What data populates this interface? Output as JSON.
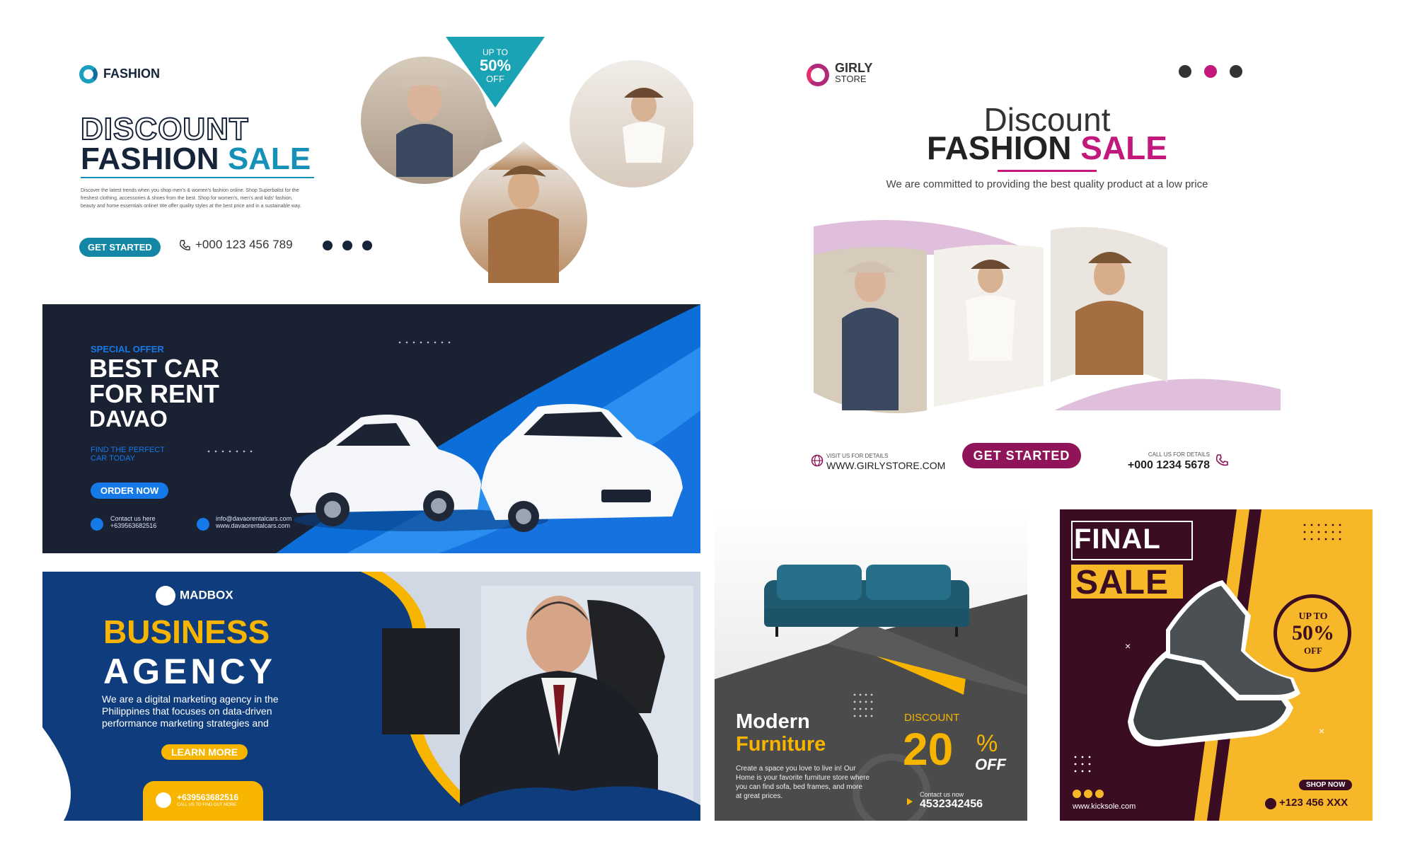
{
  "fashion_banner": {
    "brand": "FASHION",
    "headline_outline": "DISCOUNT",
    "headline_main": "FASHION",
    "headline_highlight": "SALE",
    "description": "Discover the latest trends when you shop men's & women's fashion online. Shop Superbalist for the freshest clothing, accessories & shoes from the best. Shop for women's, men's and kids' fashion, beauty and home essentials online! We offer quality styles at the best price and in a sustainable way.",
    "cta": "GET STARTED",
    "phone": "+000 123 456 789",
    "promo_up_to": "UP TO",
    "promo_percent": "50%",
    "promo_off": "OFF",
    "social_icons": [
      "facebook-icon",
      "twitter-icon",
      "pinterest-icon"
    ],
    "accent_color": "#1591b8"
  },
  "girly_banner": {
    "brand_line1": "GIRLY",
    "brand_line2": "STORE",
    "headline_light": "Discount",
    "headline_main": "FASHION",
    "headline_highlight": "SALE",
    "subtitle": "We are committed to providing the best quality product at a low price",
    "visit_label": "VISIT US FOR DETAILS",
    "url": "WWW.GIRLYSTORE.COM",
    "cta": "GET STARTED",
    "call_label": "CALL US FOR DETAILS",
    "phone": "+000 1234 5678",
    "social_icons": [
      "facebook-icon",
      "twitter-icon",
      "pinterest-icon"
    ],
    "accent_color": "#c2177b"
  },
  "car_banner": {
    "kicker": "SPECIAL OFFER",
    "line1": "BEST CAR",
    "line2": "FOR RENT",
    "line3": "DAVAO",
    "tagline_1": "FIND THE PERFECT",
    "tagline_2": "CAR TODAY",
    "cta": "ORDER NOW",
    "contact_label": "Contact us here",
    "contact_phone": "+639563682516",
    "email": "info@davaorentalcars.com",
    "website": "www.davaorentalcars.com",
    "accent_color": "#1579e8"
  },
  "agency_banner": {
    "brand": "MADBOX",
    "headline_1": "BUSINESS",
    "headline_2": "AGENCY",
    "description": "We are a digital marketing agency in the Philippines that focuses on data-driven performance marketing strategies and",
    "cta": "LEARN MORE",
    "phone": "+639563682516",
    "phone_sub": "CALL US TO FIND OUT MORE",
    "accent_color": "#f7b500"
  },
  "furniture_banner": {
    "headline_1": "Modern",
    "headline_2": "Furniture",
    "description": "Create a space you love to live in! Our Home is your favorite furniture store where you can find sofa, bed frames, and more at great prices.",
    "discount_label": "DISCOUNT",
    "discount_value": "20",
    "discount_percent": "%",
    "discount_off": "OFF",
    "contact_label": "Contact us now",
    "contact_phone": "4532342456"
  },
  "shoe_banner": {
    "line1": "FINAL",
    "line2": "SALE",
    "up_to": "UP TO",
    "percent": "50%",
    "off": "OFF",
    "cta": "SHOP NOW",
    "phone": "+123 456 XXX",
    "url": "www.kicksole.com",
    "social_icons": [
      "facebook-icon",
      "twitter-icon",
      "instagram-icon"
    ]
  }
}
